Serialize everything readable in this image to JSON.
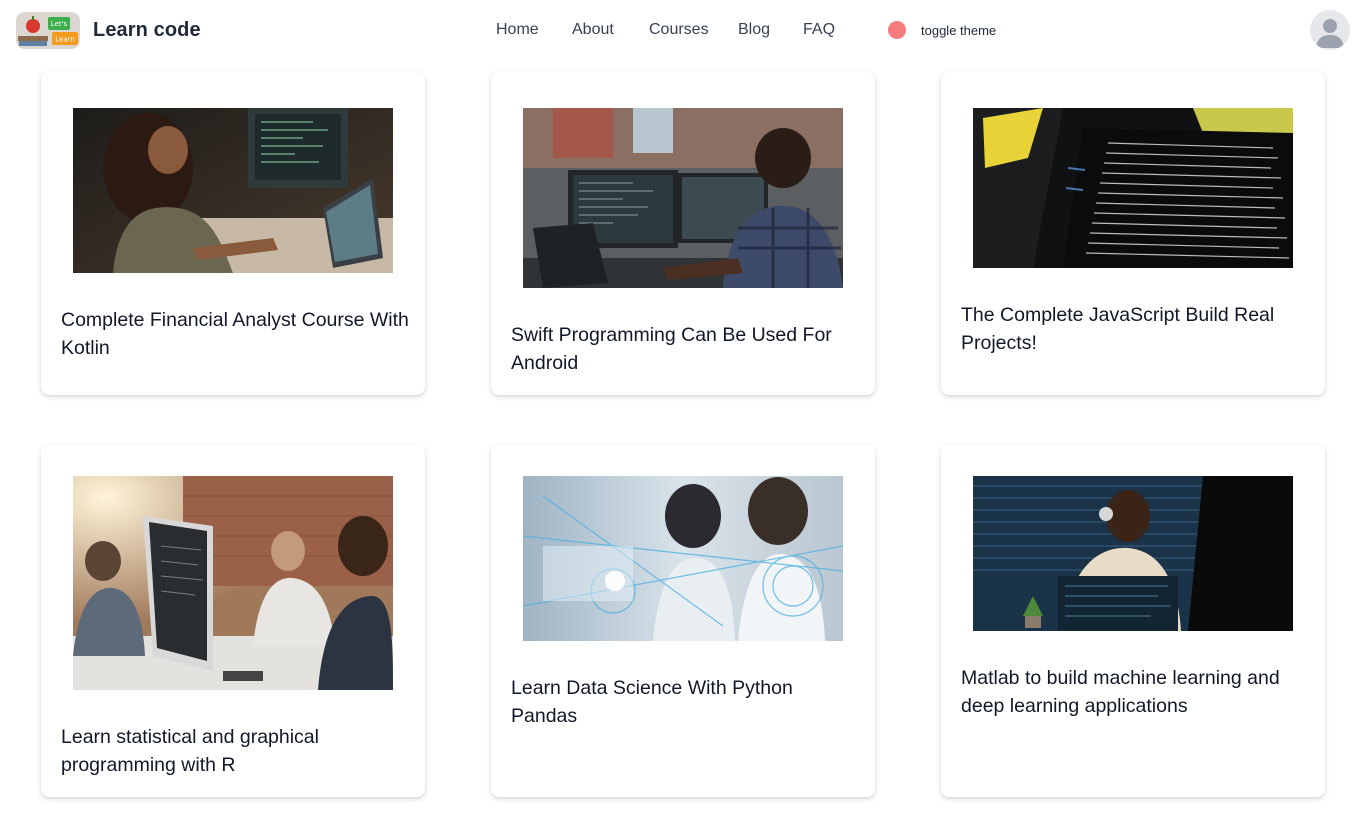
{
  "header": {
    "brand": "Learn code",
    "logo_text": [
      "Let's",
      "Learn"
    ],
    "nav": [
      {
        "label": "Home"
      },
      {
        "label": "About"
      },
      {
        "label": "Courses"
      },
      {
        "label": "Blog"
      },
      {
        "label": "FAQ"
      }
    ],
    "theme_toggle": {
      "label": "toggle theme",
      "dot_color": "#f47c7c"
    },
    "avatar_icon": "user-avatar-icon"
  },
  "courses": [
    {
      "title": "Complete Financial Analyst Course With Kotlin",
      "image": "woman-coding-at-desk-photo"
    },
    {
      "title": "Swift Programming Can Be Used For Android",
      "image": "man-coding-dual-monitors-photo"
    },
    {
      "title": "The Complete JavaScript Build Real Projects!",
      "image": "code-on-screen-closeup-photo"
    },
    {
      "title": "Learn statistical and graphical programming with R",
      "image": "team-at-computer-photo"
    },
    {
      "title": "Learn Data Science With Python Pandas",
      "image": "holographic-data-interface-photo"
    },
    {
      "title": "Matlab to build machine learning and deep learning applications",
      "image": "woman-headphones-code-overlay-photo"
    }
  ],
  "colors": {
    "accent_dot": "#f47c7c",
    "text": "#111827",
    "nav_text": "#374151"
  }
}
